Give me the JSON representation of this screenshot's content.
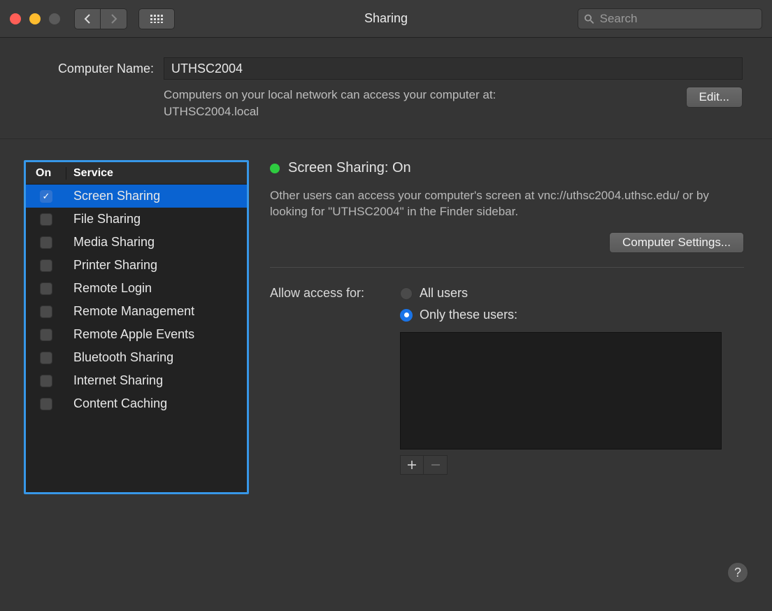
{
  "window": {
    "title": "Sharing"
  },
  "search": {
    "placeholder": "Search"
  },
  "computerName": {
    "label": "Computer Name:",
    "value": "UTHSC2004",
    "hint1": "Computers on your local network can access your computer at:",
    "hint2": "UTHSC2004.local",
    "editLabel": "Edit..."
  },
  "table": {
    "colOn": "On",
    "colService": "Service",
    "services": [
      {
        "label": "Screen Sharing",
        "on": true,
        "selected": true
      },
      {
        "label": "File Sharing",
        "on": false,
        "selected": false
      },
      {
        "label": "Media Sharing",
        "on": false,
        "selected": false
      },
      {
        "label": "Printer Sharing",
        "on": false,
        "selected": false
      },
      {
        "label": "Remote Login",
        "on": false,
        "selected": false
      },
      {
        "label": "Remote Management",
        "on": false,
        "selected": false
      },
      {
        "label": "Remote Apple Events",
        "on": false,
        "selected": false
      },
      {
        "label": "Bluetooth Sharing",
        "on": false,
        "selected": false
      },
      {
        "label": "Internet Sharing",
        "on": false,
        "selected": false
      },
      {
        "label": "Content Caching",
        "on": false,
        "selected": false
      }
    ]
  },
  "detail": {
    "statusTitle": "Screen Sharing: On",
    "description": "Other users can access your computer's screen at vnc://uthsc2004.uthsc.edu/ or by looking for \"UTHSC2004\" in the Finder sidebar.",
    "computerSettings": "Computer Settings...",
    "allowAccessLabel": "Allow access for:",
    "radioAll": "All users",
    "radioOnly": "Only these users:",
    "selectedRadio": "only"
  },
  "help": "?"
}
